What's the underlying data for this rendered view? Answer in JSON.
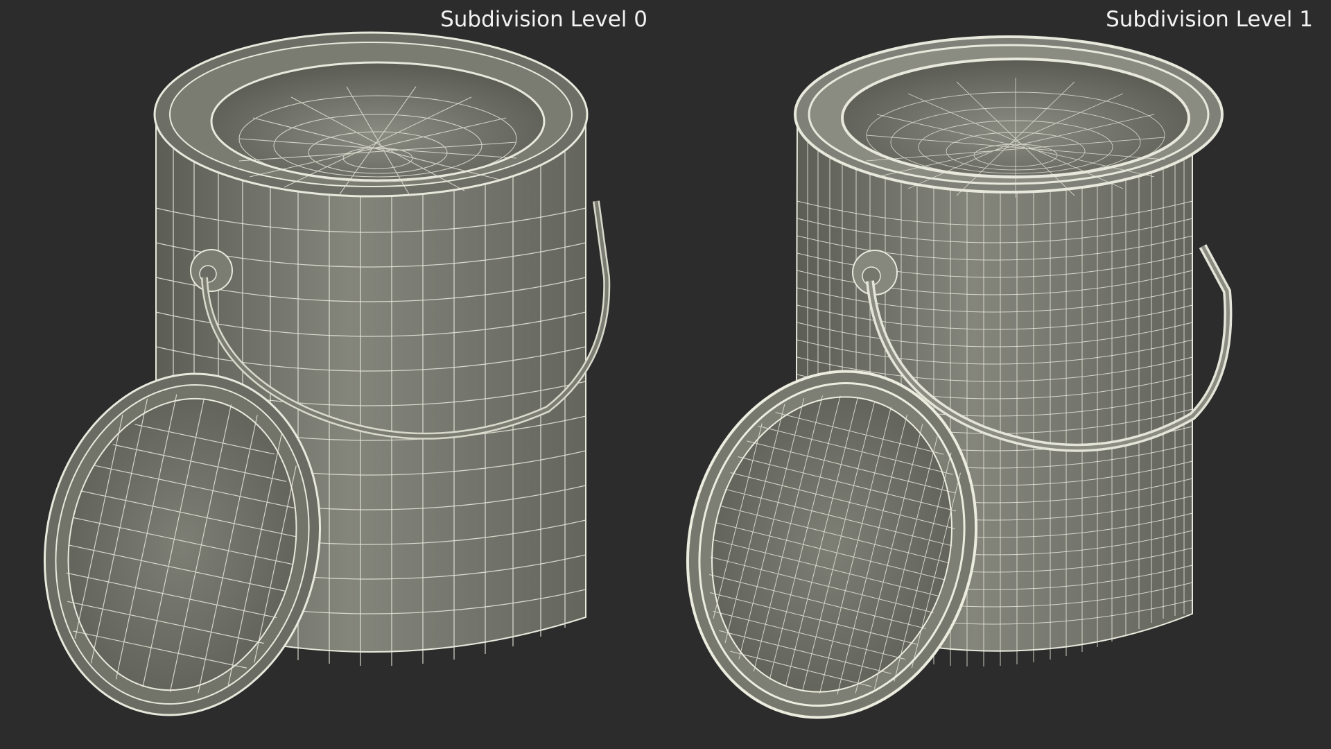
{
  "labels": {
    "left": "Subdivision Level 0",
    "right": "Subdivision Level 1"
  },
  "colors": {
    "background": "#2c2c2c",
    "surface": "#7b7c72",
    "wire": "#e8e8dc",
    "label_text": "#f2f2f2"
  },
  "panels": [
    {
      "name": "subdivision-level-0",
      "wire_density": "coarse"
    },
    {
      "name": "subdivision-level-1",
      "wire_density": "fine"
    }
  ]
}
